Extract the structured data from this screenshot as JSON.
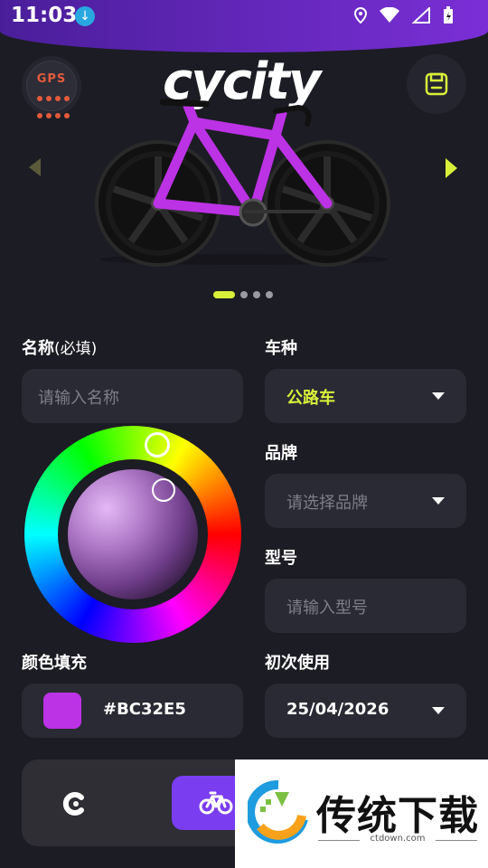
{
  "status_bar": {
    "time": "11:03"
  },
  "header": {
    "gps_label": "GPS",
    "logo": "cycity"
  },
  "carousel": {
    "page_count": 4,
    "active_index": 0
  },
  "form": {
    "name_label": "名称",
    "name_required": "(必填)",
    "name_placeholder": "请输入名称",
    "type_label": "车种",
    "type_value": "公路车",
    "brand_label": "品牌",
    "brand_placeholder": "请选择品牌",
    "model_label": "型号",
    "model_placeholder": "请输入型号",
    "color_label": "颜色填充",
    "color_hex": "#BC32E5",
    "first_use_label": "初次使用",
    "first_use_value": "25/04/2026"
  },
  "colors": {
    "accent": "#d9f03a",
    "purple": "#7a3df0",
    "bike_color": "#BC32E5"
  },
  "watermark": {
    "title": "传统下载",
    "url": "ctdown.com"
  }
}
